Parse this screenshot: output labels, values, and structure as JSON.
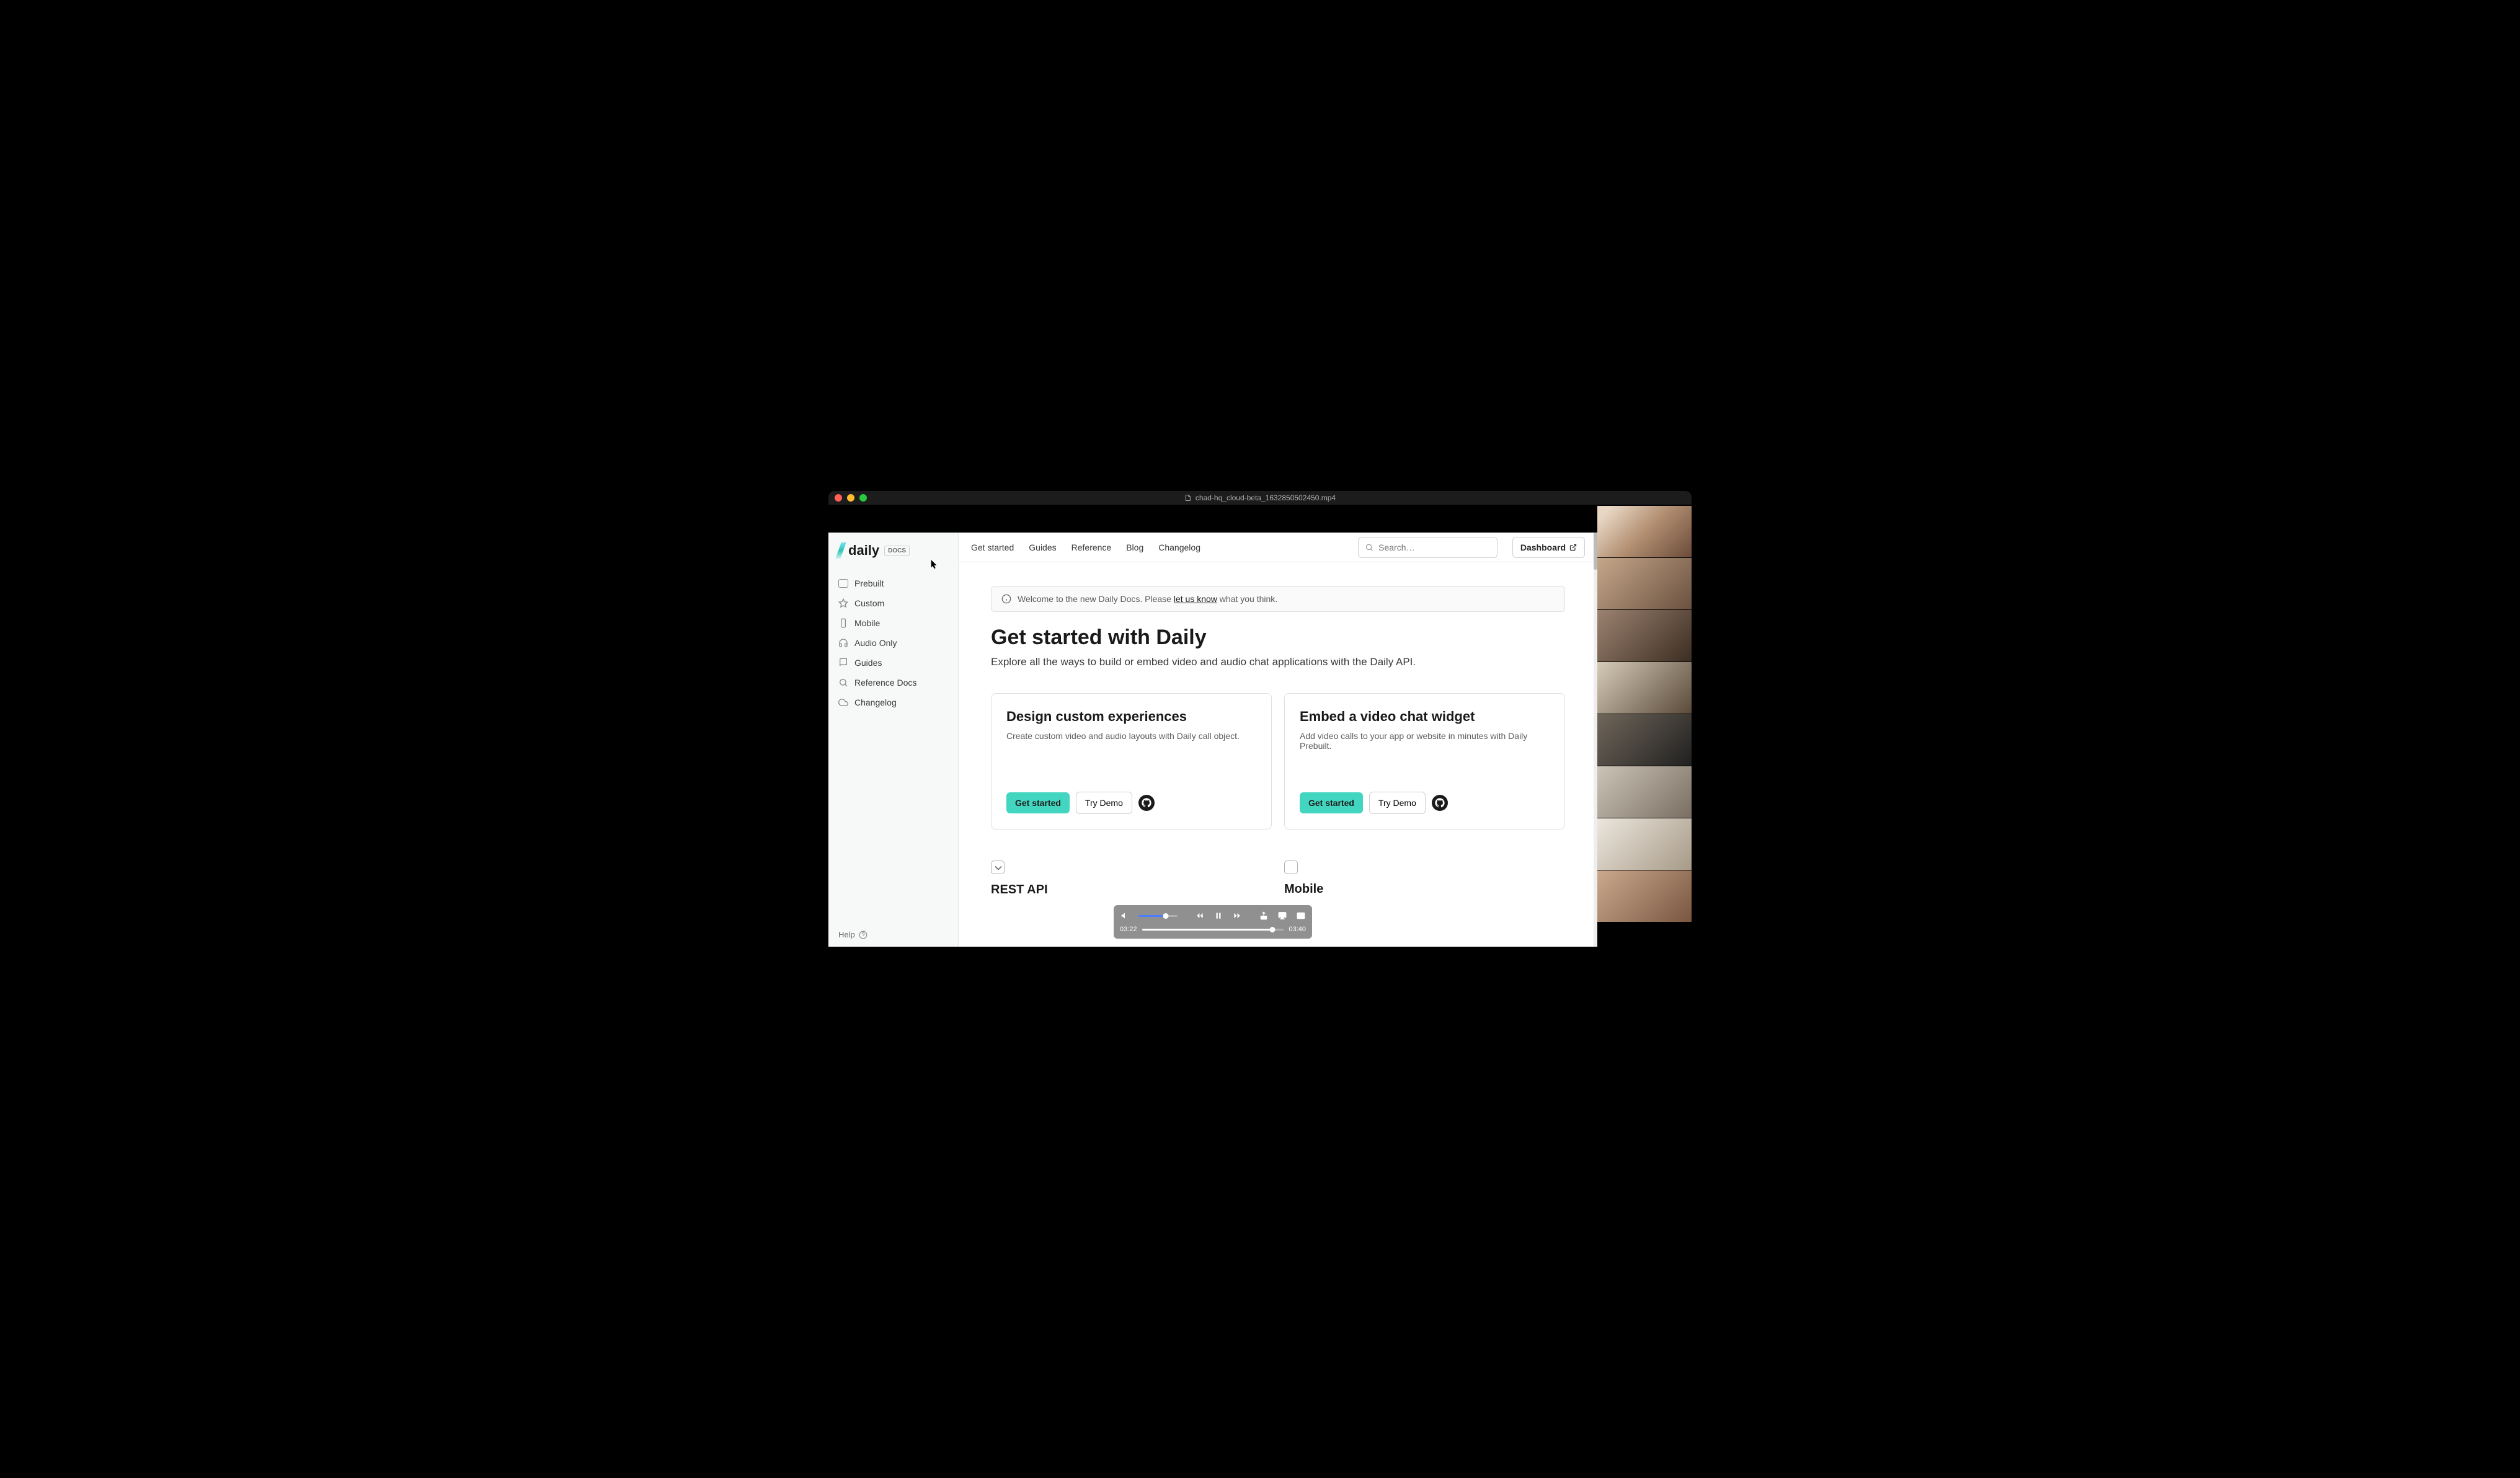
{
  "window": {
    "filename": "chad-hq_cloud-beta_1632850502450.mp4"
  },
  "brand": {
    "name": "daily",
    "docs_badge": "DOCS"
  },
  "nav": {
    "items": [
      {
        "label": "Get started"
      },
      {
        "label": "Guides"
      },
      {
        "label": "Reference"
      },
      {
        "label": "Blog"
      },
      {
        "label": "Changelog"
      }
    ],
    "search_placeholder": "Search…",
    "dashboard_label": "Dashboard"
  },
  "sidebar": {
    "items": [
      {
        "label": "Prebuilt"
      },
      {
        "label": "Custom"
      },
      {
        "label": "Mobile"
      },
      {
        "label": "Audio Only"
      },
      {
        "label": "Guides"
      },
      {
        "label": "Reference Docs"
      },
      {
        "label": "Changelog"
      }
    ],
    "help_label": "Help"
  },
  "notice": {
    "prefix": "Welcome to the new Daily Docs. Please ",
    "link": "let us know",
    "suffix": " what you think."
  },
  "page": {
    "title": "Get started with Daily",
    "lead": "Explore all the ways to build or embed video and audio chat applications with the Daily API."
  },
  "cards": [
    {
      "title": "Design custom experiences",
      "desc": "Create custom video and audio layouts with Daily call object.",
      "primary": "Get started",
      "secondary": "Try Demo"
    },
    {
      "title": "Embed a video chat widget",
      "desc": "Add video calls to your app or website in minutes with Daily Prebuilt.",
      "primary": "Get started",
      "secondary": "Try Demo"
    }
  ],
  "sections": [
    {
      "title": "REST API"
    },
    {
      "title": "Mobile"
    }
  ],
  "playback": {
    "current": "03:22",
    "total": "03:40"
  },
  "participants_count": 8
}
